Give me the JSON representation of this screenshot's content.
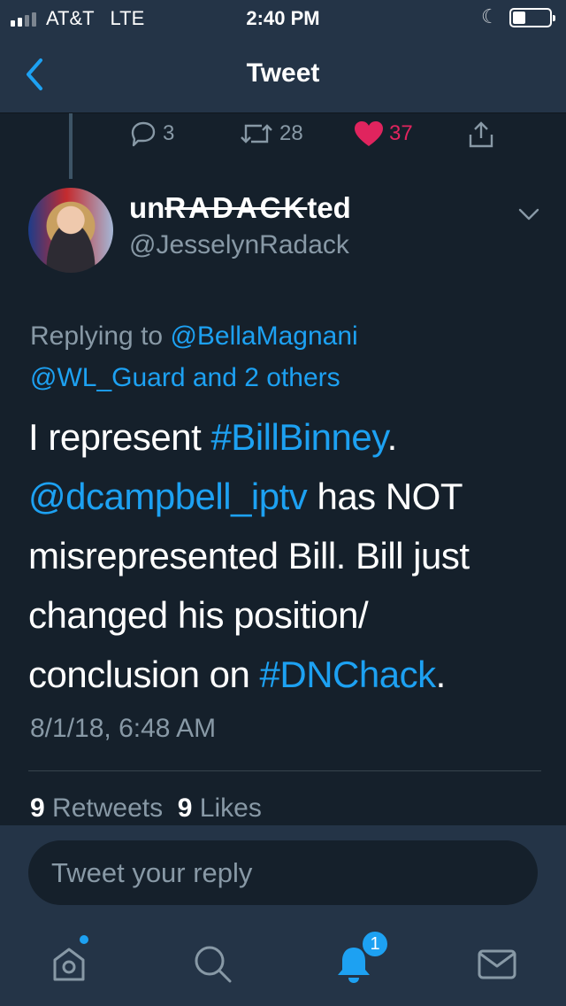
{
  "status_bar": {
    "carrier": "AT&T   LTE",
    "time": "2:40 PM",
    "signal_bars_active": 2,
    "battery_level": 0.35
  },
  "nav": {
    "title": "Tweet",
    "back_icon": "chevron-left-icon"
  },
  "parent_actions": {
    "replies": "3",
    "retweets": "28",
    "likes": "37",
    "like_color": "#e0245e"
  },
  "tweet": {
    "name_prefix": "un",
    "name_struck": "RADACK",
    "name_suffix": "ted",
    "handle": "@JesselynRadack",
    "replying_label": "Replying to ",
    "replying_user1": "@BellaMagnani",
    "replying_user2": "@WL_Guard and 2 others",
    "text_1": "I represent ",
    "hashtag_1": "#BillBinney",
    "text_2": ".",
    "mention_1": "@dcampbell_iptv",
    "text_3": " has NOT misrepresented Bill. Bill just changed his position/ conclusion on ",
    "hashtag_2": "#DNChack",
    "text_4": ".",
    "timestamp": "8/1/18, 6:48 AM",
    "retweet_count": "9",
    "retweet_label": "Retweets",
    "like_count": "9",
    "like_label": "Likes"
  },
  "reply": {
    "placeholder": "Tweet your reply"
  },
  "tabbar": {
    "items": [
      {
        "icon": "home-icon"
      },
      {
        "icon": "search-icon"
      },
      {
        "icon": "notifications-bell-icon"
      },
      {
        "icon": "messages-envelope-icon"
      }
    ],
    "notification_badge": "1"
  },
  "colors": {
    "background": "#15202b",
    "bar": "#243447",
    "accent": "#1da1f2",
    "muted": "#8899a6",
    "like": "#e0245e"
  }
}
